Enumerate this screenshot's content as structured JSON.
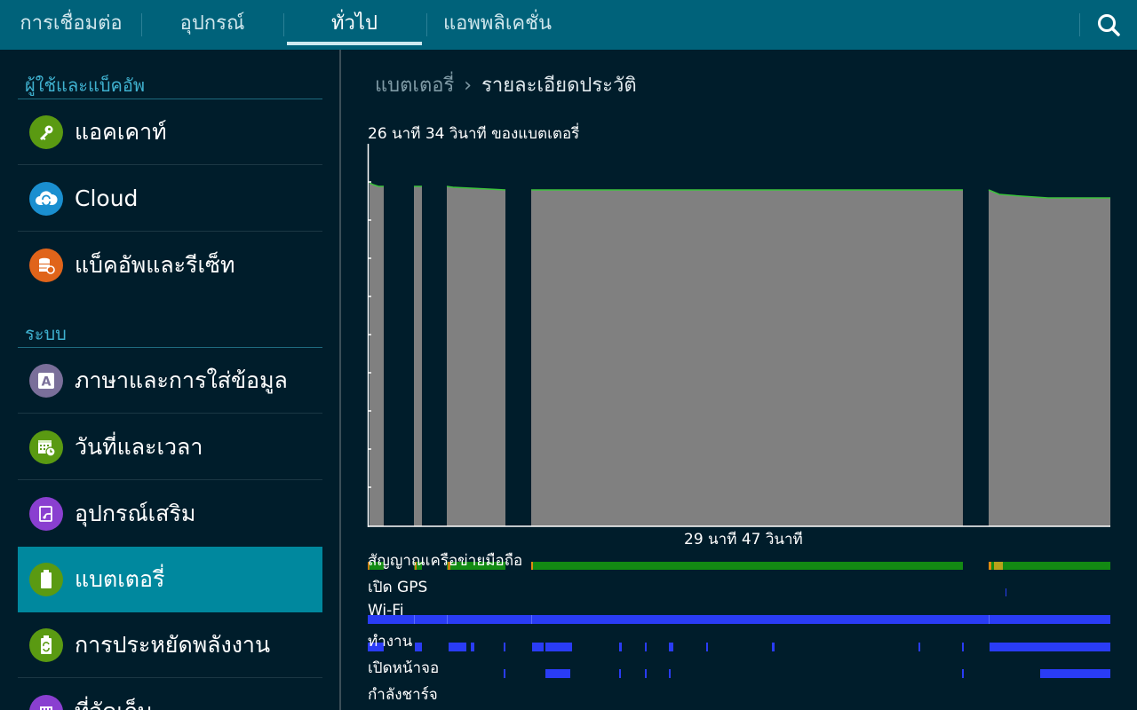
{
  "topbar": {
    "tabs": [
      {
        "label": "การเชื่อมต่อ"
      },
      {
        "label": "อุปกรณ์"
      },
      {
        "label": "ทั่วไป"
      },
      {
        "label": "แอพพลิเคชั่น"
      }
    ],
    "active_tab": "ทั่วไป",
    "search_icon": "search-icon"
  },
  "sidebar": {
    "sections": [
      {
        "title": "ผู้ใช้และแบ็คอัพ"
      },
      {
        "title": "ระบบ"
      }
    ],
    "items": [
      {
        "label": "แอคเคาท์",
        "icon": "key-icon",
        "color": "#5a9a12"
      },
      {
        "label": "Cloud",
        "icon": "cloud-sync-icon",
        "color": "#1a8fd0"
      },
      {
        "label": "แบ็คอัพและรีเซ็ท",
        "icon": "backup-reset-icon",
        "color": "#e0641a"
      },
      {
        "label": "ภาษาและการใส่ข้อมูล",
        "icon": "language-icon",
        "color": "#7a6f9a"
      },
      {
        "label": "วันที่และเวลา",
        "icon": "calendar-clock-icon",
        "color": "#5a9a12"
      },
      {
        "label": "อุปกรณ์เสริม",
        "icon": "accessory-icon",
        "color": "#8a3fd0"
      },
      {
        "label": "แบตเตอรี่",
        "icon": "battery-icon",
        "color": "#5a9a12",
        "active": true
      },
      {
        "label": "การประหยัดพลังงาน",
        "icon": "power-saving-icon",
        "color": "#5a9a12"
      },
      {
        "label": "ที่จัดเก็บ",
        "icon": "storage-icon",
        "color": "#8a3fd0"
      }
    ]
  },
  "breadcrumb": {
    "parent": "แบตเตอรี่",
    "separator": "›",
    "current": "รายละเอียดประวัติ"
  },
  "battery_chart": {
    "top_label": "26 นาที 34 วินาที ของแบตเตอรี่",
    "bottom_label": "29 นาที 47 วินาที",
    "fill_color": "#808080",
    "line_color": "#3cc23c"
  },
  "tracks": [
    {
      "label": "สัญญาณเครือข่ายมือถือ"
    },
    {
      "label": "เปิด GPS"
    },
    {
      "label": "Wi-Fi"
    },
    {
      "label": "ทำงาน"
    },
    {
      "label": "เปิดหน้าจอ"
    },
    {
      "label": "กำลังชาร์จ"
    }
  ],
  "colors": {
    "topbar": "#00627a",
    "active_item": "#00889e",
    "section_title": "#3fb1cf",
    "signal_green": "#138a13",
    "track_blue": "#2a3cf5"
  }
}
